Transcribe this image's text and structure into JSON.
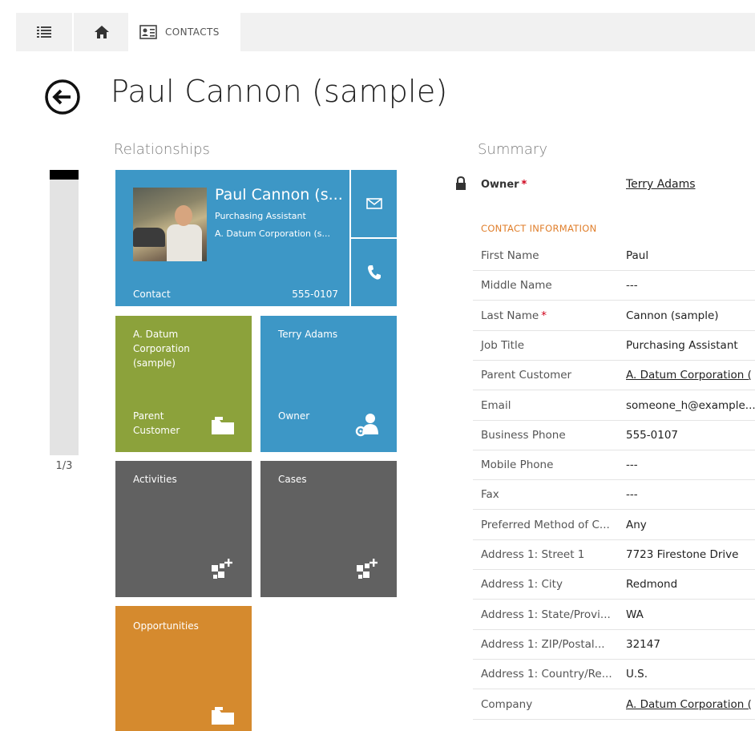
{
  "nav": {
    "section_label": "CONTACTS"
  },
  "page": {
    "title": "Paul Cannon (sample)"
  },
  "relationships": {
    "heading": "Relationships",
    "page_indicator": "1/3",
    "contact_tile": {
      "name": "Paul Cannon (s...",
      "job_title": "Purchasing Assistant",
      "company": "A. Datum Corporation (s...",
      "type": "Contact",
      "phone": "555-0107"
    },
    "account_tile": {
      "name": "A. Datum Corporation (sample)",
      "label": "Parent Customer"
    },
    "owner_tile": {
      "name": "Terry Adams",
      "label": "Owner"
    },
    "activities_tile": {
      "label": "Activities"
    },
    "cases_tile": {
      "label": "Cases"
    },
    "opportunities_tile": {
      "label": "Opportunities"
    }
  },
  "summary": {
    "heading": "Summary",
    "owner": {
      "label": "Owner",
      "value": "Terry Adams"
    },
    "section_title": "CONTACT INFORMATION",
    "fields": [
      {
        "label": "First Name",
        "value": "Paul"
      },
      {
        "label": "Middle Name",
        "value": "---"
      },
      {
        "label": "Last Name",
        "value": "Cannon (sample)",
        "required": true
      },
      {
        "label": "Job Title",
        "value": "Purchasing Assistant"
      },
      {
        "label": "Parent Customer",
        "value": "A. Datum Corporation (",
        "link": true
      },
      {
        "label": "Email",
        "value": "someone_h@example..."
      },
      {
        "label": "Business Phone",
        "value": "555-0107"
      },
      {
        "label": "Mobile Phone",
        "value": "---"
      },
      {
        "label": "Fax",
        "value": "---"
      },
      {
        "label": "Preferred Method of C...",
        "value": "Any"
      },
      {
        "label": "Address 1: Street 1",
        "value": "7723 Firestone Drive"
      },
      {
        "label": "Address 1: City",
        "value": "Redmond"
      },
      {
        "label": "Address 1: State/Provi...",
        "value": "WA"
      },
      {
        "label": "Address 1: ZIP/Postal...",
        "value": "32147"
      },
      {
        "label": "Address 1: Country/Re...",
        "value": "U.S."
      },
      {
        "label": "Company",
        "value": "A. Datum Corporation (",
        "link": true
      }
    ]
  },
  "colors": {
    "tile_blue": "#3d97c6",
    "tile_green": "#8ca23b",
    "tile_gray": "#616161",
    "tile_orange": "#d58a2e",
    "section_accent": "#e07f2c",
    "required": "#d0021b"
  },
  "icons": [
    "menu-icon",
    "home-icon",
    "contacts-icon",
    "back-arrow-icon",
    "email-icon",
    "phone-icon",
    "folder-icon",
    "owner-icon",
    "add-activity-icon",
    "add-case-icon",
    "lock-icon"
  ]
}
